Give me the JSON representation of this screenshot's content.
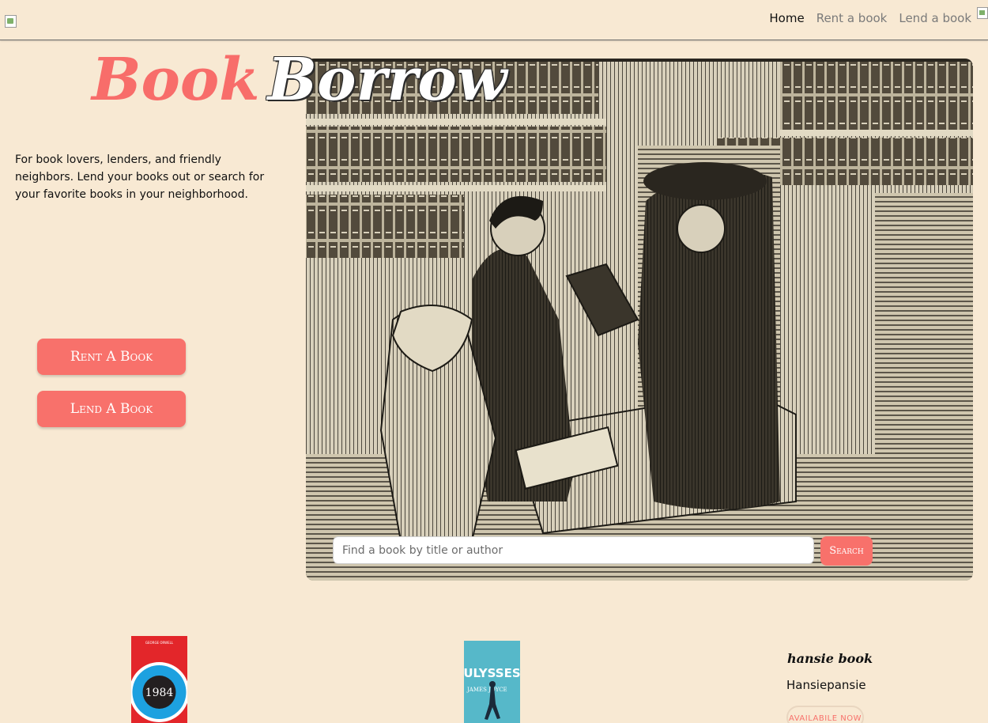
{
  "nav": {
    "links": [
      {
        "label": "Home",
        "active": true
      },
      {
        "label": "Rent a book",
        "active": false
      },
      {
        "label": "Lend a book",
        "active": false
      }
    ]
  },
  "brand": {
    "part1": "Book",
    "part2": "Borrow"
  },
  "tagline": "For book lovers, lenders, and friendly neighbors. Lend your books out or search for your favorite books in your neighborhood.",
  "buttons": {
    "rent": "Rent A Book",
    "lend": "Lend A Book"
  },
  "search": {
    "placeholder": "Find a book by title or author",
    "button": "Search"
  },
  "books": [
    {
      "cover_title": "1984",
      "cover_author": "GEORGE ORWELL"
    },
    {
      "cover_title": "ULYSSES",
      "cover_author": "JAMES JOYCE"
    }
  ],
  "listing": {
    "title": "hansie book",
    "author": "Hansiepansie",
    "status": "AVAILABILE NOW"
  },
  "colors": {
    "background": "#f8e9d3",
    "accent": "#f8716b",
    "text": "#111111"
  },
  "icons": {
    "logo": "broken-image-icon",
    "avatar": "broken-image-icon"
  }
}
